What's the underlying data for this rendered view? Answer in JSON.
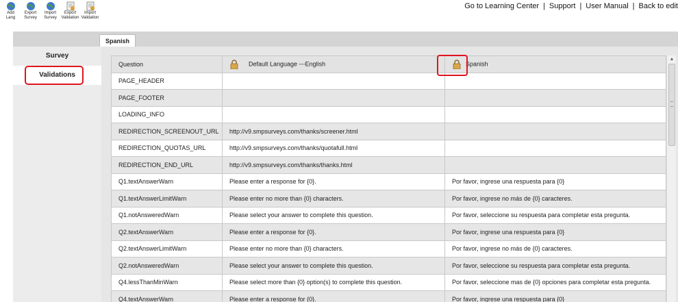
{
  "toolbar": [
    {
      "label": "Add\nLang",
      "icon": "globe-add-icon"
    },
    {
      "label": "Export\nSurvey",
      "icon": "globe-export-icon"
    },
    {
      "label": "Import\nSurvey",
      "icon": "globe-import-icon"
    },
    {
      "label": "Export\nValidation",
      "icon": "doc-export-icon"
    },
    {
      "label": "Import\nValidation",
      "icon": "doc-import-icon"
    }
  ],
  "toplinks": [
    "Go to Learning Center",
    "Support",
    "User Manual",
    "Back to edit"
  ],
  "tab": "Spanish",
  "nav": [
    "Survey",
    "Validations"
  ],
  "columns": [
    "Question",
    "Default Language ---English",
    "Spanish"
  ],
  "rows": [
    [
      "PAGE_HEADER",
      "",
      ""
    ],
    [
      "PAGE_FOOTER",
      "",
      ""
    ],
    [
      "LOADING_INFO",
      "",
      ""
    ],
    [
      "REDIRECTION_SCREENOUT_URL",
      "http://v9.smpsurveys.com/thanks/screener.html",
      ""
    ],
    [
      "REDIRECTION_QUOTAS_URL",
      "http://v9.smpsurveys.com/thanks/quotafull.html",
      ""
    ],
    [
      "REDIRECTION_END_URL",
      "http://v9.smpsurveys.com/thanks/thanks.html",
      ""
    ],
    [
      "Q1.textAnswerWarn",
      "Please enter a response for {0}.",
      "Por favor, ingrese una respuesta para {0}"
    ],
    [
      "Q1.textAnswerLimitWarn",
      "Please enter no more than {0} characters.",
      "Por favor, ingrese no más de {0} caracteres."
    ],
    [
      "Q1.notAnsweredWarn",
      "Please select your answer to complete this question.",
      "Por favor, seleccione su respuesta para completar esta pregunta."
    ],
    [
      "Q2.textAnswerWarn",
      "Please enter a response for {0}.",
      "Por favor, ingrese una respuesta para {0}"
    ],
    [
      "Q2.textAnswerLimitWarn",
      "Please enter no more than {0} characters.",
      "Por favor, ingrese no más de {0} caracteres."
    ],
    [
      "Q2.notAnsweredWarn",
      "Please select your answer to complete this question.",
      "Por favor, seleccione su respuesta para completar esta pregunta."
    ],
    [
      "Q4.lessThanMinWarn",
      "Please select more than {0} option(s) to complete this question.",
      "Por favor, seleccione mas de {0} opciones para completar esta pregunta."
    ],
    [
      "Q4.textAnswerWarn",
      "Please enter a response for {0}.",
      "Por favor, ingrese una respuesta para {0}"
    ]
  ],
  "colors": {
    "highlight": "#e0141e",
    "band": "#d4d4d4",
    "alt_row": "#e6e6e6"
  }
}
